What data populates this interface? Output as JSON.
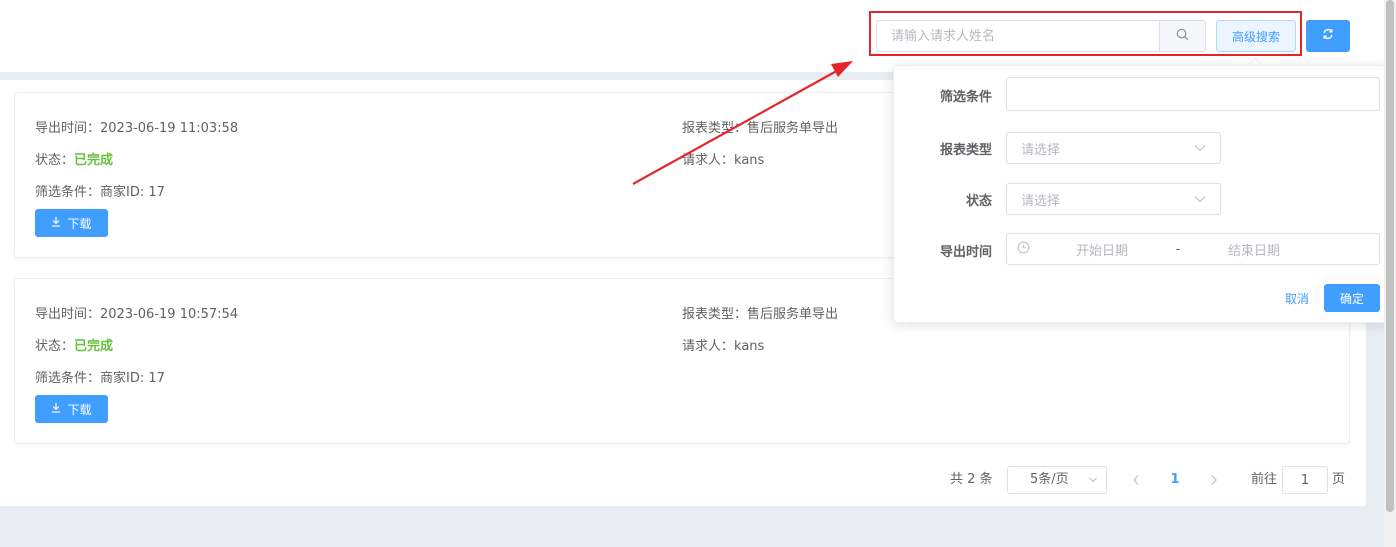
{
  "toolbar": {
    "search_placeholder": "请输入请求人姓名",
    "advanced_label": "高级搜索"
  },
  "records": [
    {
      "export_time_label": "导出时间：",
      "export_time": "2023-06-19 11:03:58",
      "status_label": "状态：",
      "status": "已完成",
      "filter_label": "筛选条件：",
      "filter": "商家ID: 17",
      "report_type_label": "报表类型：",
      "report_type": "售后服务单导出",
      "requester_label": "请求人：",
      "requester": "kans",
      "download_label": "下载"
    },
    {
      "export_time_label": "导出时间：",
      "export_time": "2023-06-19 10:57:54",
      "status_label": "状态：",
      "status": "已完成",
      "filter_label": "筛选条件：",
      "filter": "商家ID: 17",
      "report_type_label": "报表类型：",
      "report_type": "售后服务单导出",
      "requester_label": "请求人：",
      "requester": "kans",
      "download_label": "下载"
    }
  ],
  "pagination": {
    "total": "共 2 条",
    "page_size": "5条/页",
    "current_page": "1",
    "goto_label": "前往",
    "goto_value": "1",
    "page_unit": "页"
  },
  "advanced_search": {
    "filter_label": "筛选条件",
    "filter_value": "",
    "report_type_label": "报表类型",
    "report_type_placeholder": "请选择",
    "status_label": "状态",
    "status_placeholder": "请选择",
    "export_time_label": "导出时间",
    "start_placeholder": "开始日期",
    "range_separator": "-",
    "end_placeholder": "结束日期",
    "cancel_label": "取消",
    "confirm_label": "确定"
  },
  "colors": {
    "primary": "#409eff",
    "success": "#67c23a",
    "annotation": "#e4262b"
  }
}
